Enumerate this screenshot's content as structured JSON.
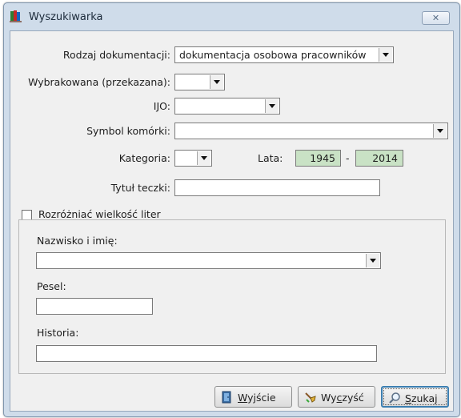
{
  "window": {
    "title": "Wyszukiwarka",
    "close_symbol": "✕",
    "icon": "app-books-icon"
  },
  "form": {
    "rodzaj": {
      "label": "Rodzaj dokumentacji:",
      "value": "dokumentacja osobowa pracowników"
    },
    "wybrakowana": {
      "label": "Wybrakowana (przekazana):",
      "value": ""
    },
    "ijo": {
      "label": "IJO:",
      "value": ""
    },
    "symbol": {
      "label": "Symbol komórki:",
      "value": ""
    },
    "kategoria": {
      "label": "Kategoria:",
      "value": ""
    },
    "lata": {
      "label": "Lata:",
      "from": "1945",
      "separator": "-",
      "to": "2014"
    },
    "tytul": {
      "label": "Tytuł teczki:",
      "value": ""
    },
    "case_sensitive": {
      "label": "Rozróżniać wielkość liter",
      "checked": false
    }
  },
  "person_panel": {
    "nazwisko": {
      "label": "Nazwisko i imię:",
      "value": ""
    },
    "pesel": {
      "label": "Pesel:",
      "value": ""
    },
    "historia": {
      "label": "Historia:",
      "value": ""
    }
  },
  "buttons": {
    "exit": {
      "mnemonic": "W",
      "rest": "yjście",
      "icon": "door-exit-icon"
    },
    "clear": {
      "pre": "Wy",
      "mnemonic": "c",
      "rest": "zyść",
      "icon": "broom-icon"
    },
    "search": {
      "mnemonic": "S",
      "rest": "zukaj",
      "icon": "magnifier-icon"
    }
  }
}
